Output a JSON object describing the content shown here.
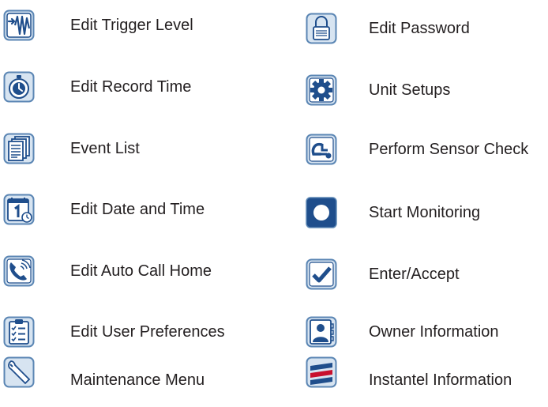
{
  "colors": {
    "icon_blue": "#1f4e8c",
    "icon_frame": "#5b86b4",
    "icon_light": "#d7e4f1",
    "text": "#231f20",
    "accent_red": "#c8102e"
  },
  "left_items": [
    {
      "label": "Edit Trigger Level",
      "icon": "trigger-level-icon"
    },
    {
      "label": "Edit Record Time",
      "icon": "stopwatch-icon"
    },
    {
      "label": "Event List",
      "icon": "documents-icon"
    },
    {
      "label": "Edit Date and Time",
      "icon": "calendar-clock-icon"
    },
    {
      "label": "Edit Auto Call Home",
      "icon": "phone-icon"
    },
    {
      "label": "Edit User Preferences",
      "icon": "clipboard-checklist-icon"
    },
    {
      "label": "Maintenance Menu",
      "icon": "wrench-icon"
    }
  ],
  "right_items": [
    {
      "label": "Edit Password",
      "icon": "lock-icon"
    },
    {
      "label": "Unit Setups",
      "icon": "gear-icon"
    },
    {
      "label": "Perform Sensor Check",
      "icon": "sensor-check-icon"
    },
    {
      "label": "Start Monitoring",
      "icon": "record-icon"
    },
    {
      "label": "Enter/Accept",
      "icon": "checkmark-icon"
    },
    {
      "label": "Owner Information",
      "icon": "owner-contact-icon"
    },
    {
      "label": "Instantel Information",
      "icon": "instantel-logo-icon"
    }
  ]
}
